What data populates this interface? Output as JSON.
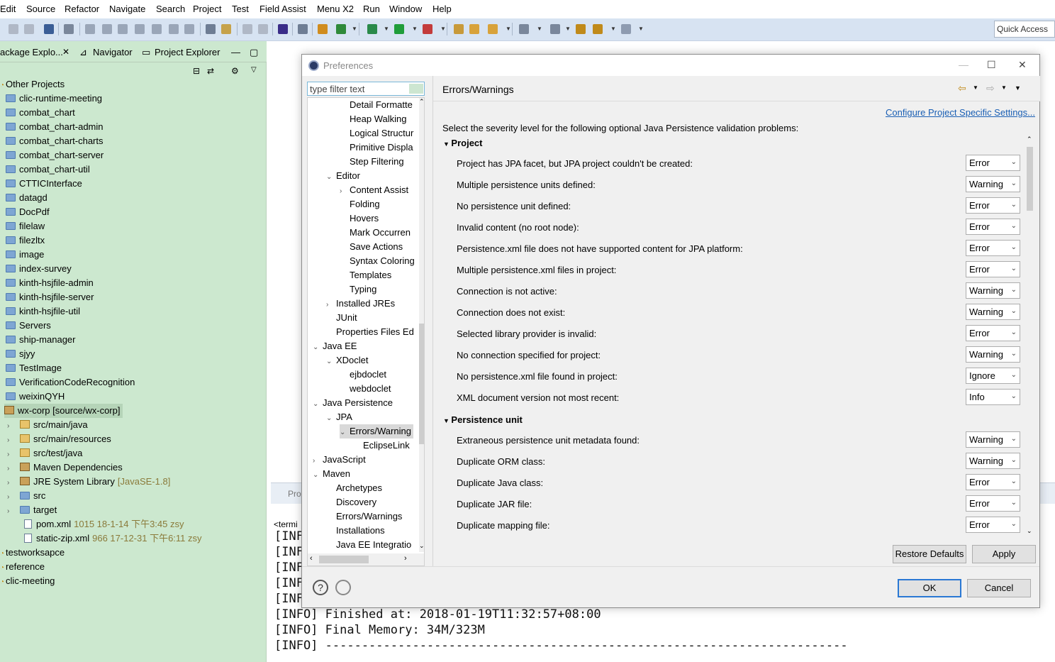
{
  "menu": [
    "Edit",
    "Source",
    "Refactor",
    "Navigate",
    "Search",
    "Project",
    "Test",
    "Field Assist",
    "Menu X2",
    "Run",
    "Window",
    "Help"
  ],
  "toolbar": {
    "quick_access": "Quick Access"
  },
  "left_panel": {
    "tabs": [
      "ackage Explo...",
      "Navigator",
      "Project Explorer"
    ],
    "items": [
      {
        "label": "Other Projects",
        "type": "group"
      },
      {
        "label": "clic-runtime-meeting"
      },
      {
        "label": "combat_chart"
      },
      {
        "label": "combat_chart-admin"
      },
      {
        "label": "combat_chart-charts"
      },
      {
        "label": "combat_chart-server"
      },
      {
        "label": "combat_chart-util"
      },
      {
        "label": "CTTICInterface"
      },
      {
        "label": "datagd"
      },
      {
        "label": "DocPdf"
      },
      {
        "label": "filelaw"
      },
      {
        "label": "filezltx"
      },
      {
        "label": "image"
      },
      {
        "label": "index-survey"
      },
      {
        "label": "kinth-hsjfile-admin"
      },
      {
        "label": "kinth-hsjfile-server"
      },
      {
        "label": "kinth-hsjfile-util"
      },
      {
        "label": "Servers"
      },
      {
        "label": "ship-manager"
      },
      {
        "label": "sjyy"
      },
      {
        "label": "TestImage"
      },
      {
        "label": "VerificationCodeRecognition"
      },
      {
        "label": "weixinQYH"
      },
      {
        "label": "wx-corp [source/wx-corp]"
      }
    ],
    "children": [
      {
        "label": "src/main/java"
      },
      {
        "label": "src/main/resources"
      },
      {
        "label": "src/test/java"
      },
      {
        "label": "Maven Dependencies"
      },
      {
        "label": "JRE System Library",
        "extra": "[JavaSE-1.8]"
      },
      {
        "label": "src"
      },
      {
        "label": "target"
      }
    ],
    "files": [
      {
        "label": "pom.xml",
        "extra": "1015  18-1-14 下午3:45  zsy"
      },
      {
        "label": "static-zip.xml",
        "extra": "966  17-12-31 下午6:11  zsy"
      }
    ],
    "tail": [
      "testworksapce",
      "reference",
      "clic-meeting"
    ]
  },
  "console": {
    "tab": "Pro",
    "label": "<termi",
    "lines": [
      "[INF",
      "[INF",
      "[INF",
      "[INF",
      "[INF",
      "[INFO] Finished at: 2018-01-19T11:32:57+08:00",
      "[INFO] Final Memory: 34M/323M",
      "[INFO] ------------------------------------------------------------------------"
    ]
  },
  "dialog": {
    "title": "Preferences",
    "filter_placeholder": "type filter text",
    "tree": [
      {
        "label": "Detail Formatte",
        "indent": 3
      },
      {
        "label": "Heap Walking",
        "indent": 3
      },
      {
        "label": "Logical Structur",
        "indent": 3
      },
      {
        "label": "Primitive Displa",
        "indent": 3
      },
      {
        "label": "Step Filtering",
        "indent": 3
      },
      {
        "label": "Editor",
        "indent": 2,
        "open": true
      },
      {
        "label": "Content Assist",
        "indent": 3,
        "closed": true
      },
      {
        "label": "Folding",
        "indent": 3
      },
      {
        "label": "Hovers",
        "indent": 3
      },
      {
        "label": "Mark Occurren",
        "indent": 3
      },
      {
        "label": "Save Actions",
        "indent": 3
      },
      {
        "label": "Syntax Coloring",
        "indent": 3
      },
      {
        "label": "Templates",
        "indent": 3
      },
      {
        "label": "Typing",
        "indent": 3
      },
      {
        "label": "Installed JREs",
        "indent": 2,
        "closed": true
      },
      {
        "label": "JUnit",
        "indent": 2
      },
      {
        "label": "Properties Files Ed",
        "indent": 2
      },
      {
        "label": "Java EE",
        "indent": 1,
        "open": true
      },
      {
        "label": "XDoclet",
        "indent": 2,
        "open": true
      },
      {
        "label": "ejbdoclet",
        "indent": 3
      },
      {
        "label": "webdoclet",
        "indent": 3
      },
      {
        "label": "Java Persistence",
        "indent": 1,
        "open": true
      },
      {
        "label": "JPA",
        "indent": 2,
        "open": true
      },
      {
        "label": "Errors/Warning",
        "indent": 3,
        "open": true,
        "selected": true
      },
      {
        "label": "EclipseLink",
        "indent": 4
      },
      {
        "label": "JavaScript",
        "indent": 1,
        "closed": true
      },
      {
        "label": "Maven",
        "indent": 1,
        "open": true
      },
      {
        "label": "Archetypes",
        "indent": 2
      },
      {
        "label": "Discovery",
        "indent": 2
      },
      {
        "label": "Errors/Warnings",
        "indent": 2
      },
      {
        "label": "Installations",
        "indent": 2
      },
      {
        "label": "Java EE Integratio",
        "indent": 2
      }
    ],
    "page_title": "Errors/Warnings",
    "config_link": "Configure Project Specific Settings...",
    "description": "Select the severity level for the following optional Java Persistence validation problems:",
    "sections": [
      {
        "title": "Project",
        "options": [
          {
            "label": "Project has JPA facet, but JPA project couldn't be created:",
            "value": "Error"
          },
          {
            "label": "Multiple persistence units defined:",
            "value": "Warning"
          },
          {
            "label": "No persistence unit defined:",
            "value": "Error"
          },
          {
            "label": "Invalid content (no root node):",
            "value": "Error"
          },
          {
            "label": "Persistence.xml file does not have supported content for JPA platform:",
            "value": "Error"
          },
          {
            "label": "Multiple persistence.xml files in project:",
            "value": "Error"
          },
          {
            "label": "Connection is not active:",
            "value": "Warning"
          },
          {
            "label": "Connection does not exist:",
            "value": "Warning"
          },
          {
            "label": "Selected library provider is invalid:",
            "value": "Error"
          },
          {
            "label": "No connection specified for project:",
            "value": "Warning"
          },
          {
            "label": "No persistence.xml file found in project:",
            "value": "Ignore"
          },
          {
            "label": "XML document version not most recent:",
            "value": "Info"
          }
        ]
      },
      {
        "title": "Persistence unit",
        "options": [
          {
            "label": "Extraneous persistence unit metadata found:",
            "value": "Warning"
          },
          {
            "label": "Duplicate ORM class:",
            "value": "Warning"
          },
          {
            "label": "Duplicate Java class:",
            "value": "Error"
          },
          {
            "label": "Duplicate JAR file:",
            "value": "Error"
          },
          {
            "label": "Duplicate mapping file:",
            "value": "Error"
          }
        ]
      }
    ],
    "restore_defaults": "Restore Defaults",
    "apply": "Apply",
    "ok": "OK",
    "cancel": "Cancel",
    "help_symbol": "?"
  },
  "colors": {
    "explorer_bg": "#cce8cf",
    "toolbar_bg": "#d7e3f2",
    "link": "#1a5fb4"
  }
}
